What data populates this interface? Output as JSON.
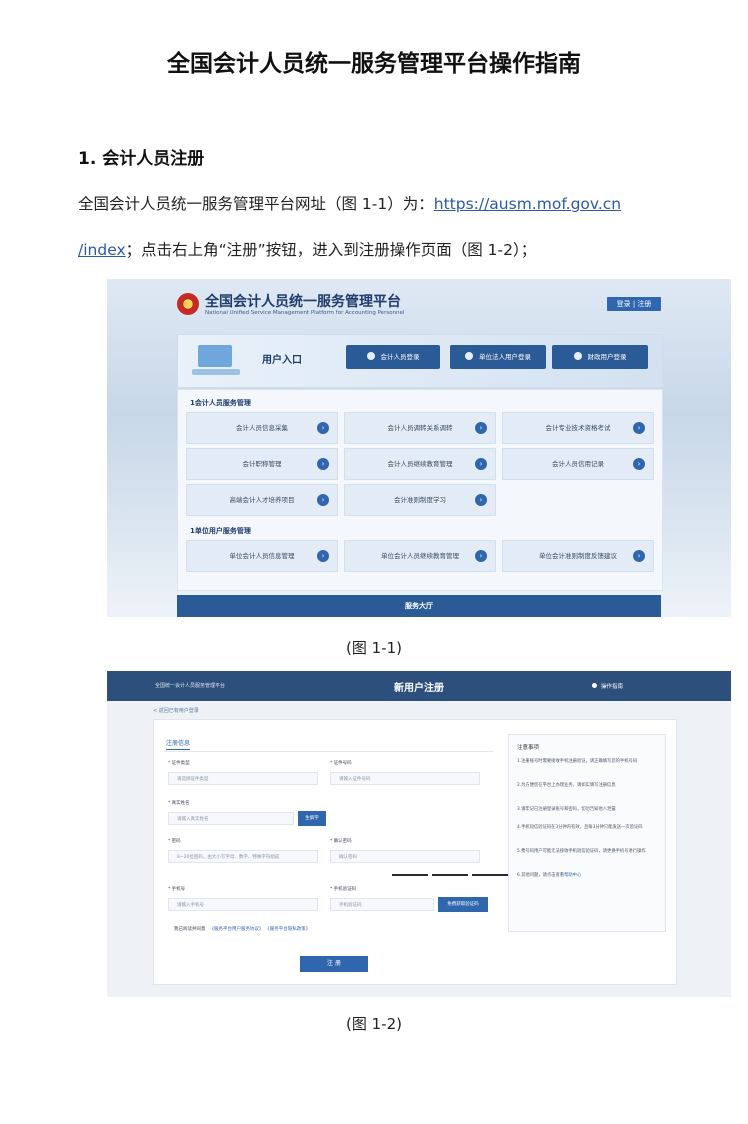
{
  "doc": {
    "title": "全国会计人员统一服务管理平台操作指南",
    "section_heading": "1.  会计人员注册",
    "para1_text": "全国会计人员统一服务管理平台网址（图 1-1）为：",
    "url_part1": "https://ausm.mof.gov.cn",
    "url_part2": "/index",
    "para2_text": "；点击右上角“注册”按钮，进入到注册操作页面（图 1-2）；",
    "caption1": "(图 1-1)",
    "caption2": "(图 1-2)"
  },
  "fig1": {
    "title": "全国会计人员统一服务管理平台",
    "subtitle": "National Unified Service Management Platform for Accounting Personnel",
    "login_register": "登录 | 注册",
    "entry_label": "用户入口",
    "buttons": [
      "会计人员登录",
      "单位法人用户登录",
      "财政用户登录"
    ],
    "group1_title": "1会计人员服务管理",
    "group1_tiles": [
      "会计人员信息采集",
      "会计人员调转关系调转",
      "会计专业技术资格考试",
      "会计职称管理",
      "会计人员继续教育管理",
      "会计人员信用记录",
      "高端会计人才培养项目",
      "会计准则制度学习"
    ],
    "group2_title": "1单位用户服务管理",
    "group2_tiles": [
      "单位会计人员信息管理",
      "单位会计人员继续教育管理",
      "单位会计准则制度反馈建议"
    ],
    "hall": "服务大厅"
  },
  "fig2": {
    "site_name": "全国统一会计人员服务管理平台",
    "page_title": "新用户注册",
    "guide": "操作指南",
    "back": "< 返回已有用户登录",
    "tab": "注册信息",
    "labels": {
      "id_type": "* 证件类型",
      "id_no": "* 证件号码",
      "name": "* 真实姓名",
      "password": "* 密码",
      "confirm": "* 确认密码",
      "phone": "* 手机号",
      "code": "* 手机验证码"
    },
    "placeholders": {
      "id_type": "请选择证件类型",
      "id_no": "请输入证件号码",
      "name": "请输入真实姓名",
      "password": "8~20位密码，由大小写字母、数字、特殊字符组成",
      "confirm": "确认密码",
      "phone": "请输入手机号",
      "code": "手机验证码"
    },
    "name_btn": "生僻字",
    "code_btn": "免费获取验证码",
    "agree": "我已阅读并同意",
    "agree_link1": "《服务平台用户服务协议》",
    "agree_link2": "《服务平台隐私政策》",
    "submit": "注 册",
    "notes_title": "注意事项",
    "notes": [
      "1.注册账号时需要接收手机注册验证，请正确填写您的手机号码",
      "2.为方便您在平台上办理业务，请如实填写注册信息",
      "3.请牢记已注册登录账号和密码，切勿告知他人泄露",
      "4.手机短信验证码在3分钟内有效，且每3分钟只能发送一次验证码",
      "5.费号码用户可能无法接收手机短信验证码，请更换手机号进行操作",
      "6.其他问题，请点击查看"
    ],
    "help_link": "帮助中心"
  }
}
